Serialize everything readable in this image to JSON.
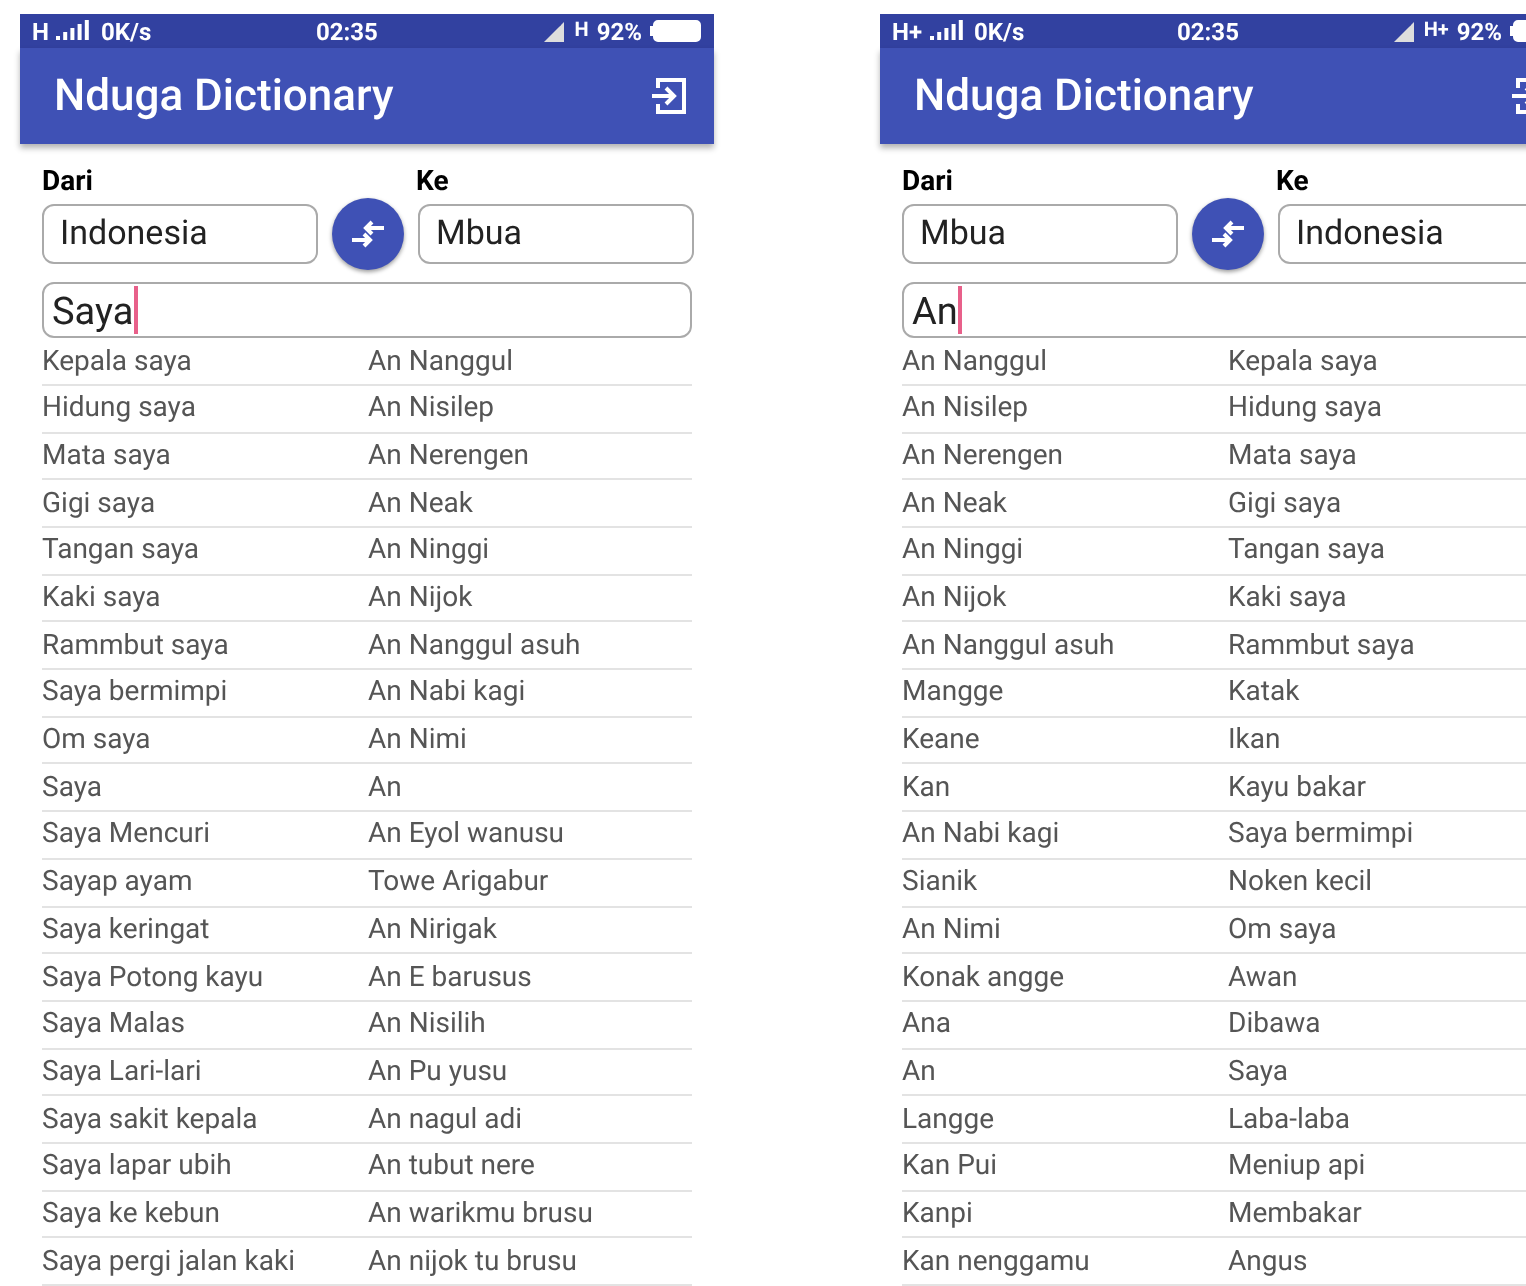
{
  "phones": [
    {
      "status_bar": {
        "network": "H",
        "speed": "0K/s",
        "time": "02:35",
        "data_type": "H",
        "battery": "92%"
      },
      "app_bar": {
        "title": "Nduga Dictionary"
      },
      "from": {
        "label": "Dari",
        "value": "Indonesia"
      },
      "to": {
        "label": "Ke",
        "value": "Mbua"
      },
      "search": {
        "value": "Saya"
      },
      "rows": [
        [
          "Kepala  saya",
          "An Nanggul"
        ],
        [
          "Hidung saya",
          "An Nisilep"
        ],
        [
          "Mata saya",
          "An Nerengen"
        ],
        [
          "Gigi saya",
          "An Neak"
        ],
        [
          "Tangan saya",
          "An Ninggi"
        ],
        [
          "Kaki saya",
          "An Nijok"
        ],
        [
          "Rammbut saya",
          "An Nanggul asuh"
        ],
        [
          "Saya bermimpi",
          "An Nabi kagi"
        ],
        [
          "Om saya",
          "An Nimi"
        ],
        [
          "Saya",
          "An"
        ],
        [
          "Saya Mencuri",
          "An Eyol wanusu"
        ],
        [
          "Sayap ayam",
          "Towe Arigabur"
        ],
        [
          "Saya keringat",
          "An Nirigak"
        ],
        [
          "Saya Potong kayu",
          "An E barusus"
        ],
        [
          "Saya Malas",
          "An Nisilih"
        ],
        [
          "Saya Lari-lari",
          "An Pu yusu"
        ],
        [
          "Saya sakit kepala",
          "An nagul adi"
        ],
        [
          "Saya lapar ubih",
          "An tubut nere"
        ],
        [
          "Saya ke kebun",
          "An warikmu brusu"
        ],
        [
          "Saya pergi jalan kaki",
          "An nijok tu brusu"
        ]
      ]
    },
    {
      "status_bar": {
        "network": "H+",
        "speed": "0K/s",
        "time": "02:35",
        "data_type": "H+",
        "battery": "92%"
      },
      "app_bar": {
        "title": "Nduga Dictionary"
      },
      "from": {
        "label": "Dari",
        "value": "Mbua"
      },
      "to": {
        "label": "Ke",
        "value": "Indonesia"
      },
      "search": {
        "value": "An"
      },
      "rows": [
        [
          "An Nanggul",
          "Kepala saya"
        ],
        [
          "An Nisilep",
          "Hidung saya"
        ],
        [
          "An Nerengen",
          "Mata saya"
        ],
        [
          "An Neak",
          "Gigi saya"
        ],
        [
          "An Ninggi",
          "Tangan saya"
        ],
        [
          "An Nijok",
          "Kaki saya"
        ],
        [
          "An Nanggul asuh",
          "Rammbut saya"
        ],
        [
          "Mangge",
          "Katak"
        ],
        [
          "Keane",
          "Ikan"
        ],
        [
          "Kan",
          "Kayu bakar"
        ],
        [
          "An Nabi kagi",
          "Saya bermimpi"
        ],
        [
          "Sianik",
          "Noken kecil"
        ],
        [
          "An Nimi",
          "Om saya"
        ],
        [
          "Konak angge",
          "Awan"
        ],
        [
          "Ana",
          "Dibawa"
        ],
        [
          "An",
          "Saya"
        ],
        [
          "Langge",
          "Laba-laba"
        ],
        [
          "Kan Pui",
          "Meniup api"
        ],
        [
          "Kanpi",
          "Membakar"
        ],
        [
          "Kan nenggamu",
          "Angus"
        ]
      ]
    }
  ]
}
